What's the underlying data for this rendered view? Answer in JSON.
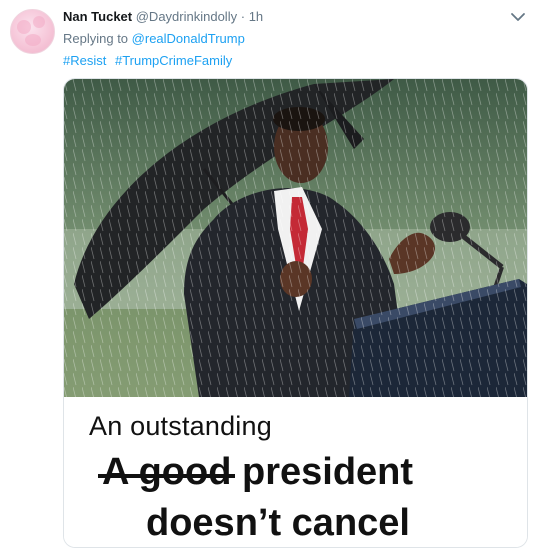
{
  "tweet": {
    "display_name": "Nan Tucket",
    "handle": "@Daydrinkindolly",
    "separator": "·",
    "time": "1h",
    "replying_prefix": "Replying to",
    "replying_to": "@realDonaldTrump",
    "hashtags": [
      "#Resist",
      "#TrumpCrimeFamily"
    ],
    "avatar_icon": "profile-avatar",
    "menu_icon": "chevron-down-icon"
  },
  "media": {
    "caption_line1": "An outstanding",
    "struck_text": "A good",
    "caption_line2_rest": "president",
    "caption_line3": "doesn’t cancel"
  },
  "colors": {
    "link": "#1da1f2",
    "muted": "#657786"
  }
}
